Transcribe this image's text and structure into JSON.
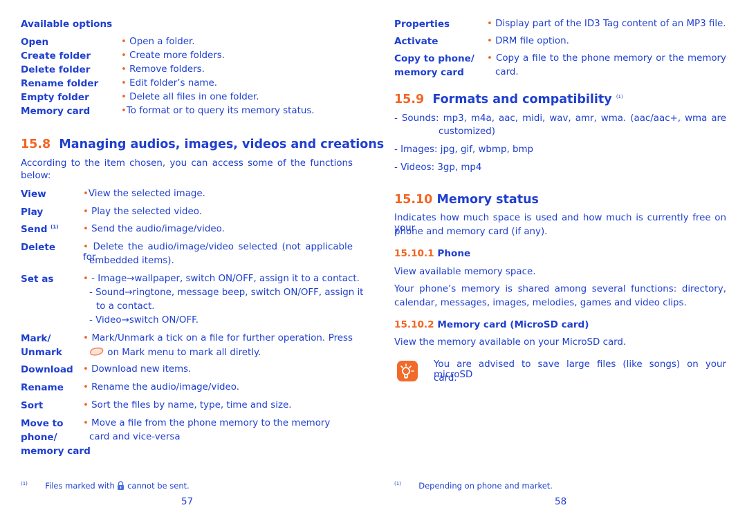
{
  "left_page": {
    "options_heading": "Available options",
    "folder_options": [
      {
        "term": "Open",
        "desc": "Open a folder."
      },
      {
        "term": "Create folder",
        "desc": "Create more folders."
      },
      {
        "term": "Delete folder",
        "desc": "Remove folders."
      },
      {
        "term": "Rename folder",
        "desc": "Edit folder’s name."
      },
      {
        "term": "Empty folder",
        "desc": "Delete all files in one folder."
      },
      {
        "term": "Memory card",
        "desc": "To format or to query its memory status."
      }
    ],
    "section": {
      "number": "15.8",
      "title": "Managing audios, images, videos and creations"
    },
    "intro_line1": "According to the item chosen, you can access some of the functions",
    "intro_line2": "below:",
    "functions": {
      "view": {
        "term": "View",
        "desc": "View the selected image."
      },
      "play": {
        "term": "Play",
        "desc": "Play the selected video."
      },
      "send": {
        "term": "Send",
        "sup": "(1)",
        "desc": "Send the audio/image/video."
      },
      "delete": {
        "term": "Delete",
        "desc_line1": "Delete the audio/image/video selected (not applicable for",
        "desc_line2": "embedded items)."
      },
      "set_as": {
        "term": "Set as",
        "line1": "- Image→wallpaper, switch ON/OFF, assign it to a contact.",
        "line2": "- Sound→ringtone, message beep, switch ON/OFF, assign it",
        "line3": "to a contact.",
        "line4": "- Video→switch ON/OFF."
      },
      "mark": {
        "term_line1": "Mark/",
        "term_line2": "Unmark",
        "desc_line1": "Mark/Unmark a tick on a file for further operation. Press",
        "desc_line2": "on Mark menu to mark all diretly."
      },
      "download": {
        "term": "Download",
        "desc": "Download new items."
      },
      "rename": {
        "term": "Rename",
        "desc": "Rename the audio/image/video."
      },
      "sort": {
        "term": "Sort",
        "desc": "Sort the files by name, type, time and size."
      },
      "move": {
        "term_line1": "Move to",
        "term_line2": "phone/",
        "term_line3": "memory card",
        "desc_line1": "Move a file from the phone memory to the memory",
        "desc_line2": "card and vice-versa"
      }
    },
    "footnote": {
      "marker": "(1)",
      "text_before": "Files marked with",
      "text_after": "cannot be sent."
    },
    "page_number": "57"
  },
  "right_page": {
    "functions": {
      "properties": {
        "term": "Properties",
        "desc": "Display part of the ID3 Tag content of an MP3 file."
      },
      "activate": {
        "term": "Activate",
        "desc": "DRM file option."
      },
      "copy": {
        "term_line1": "Copy to phone/",
        "term_line2": "memory card",
        "desc_line1": "Copy a file to the phone memory or the memory",
        "desc_line2": "card."
      }
    },
    "section_formats": {
      "number": "15.9",
      "title": "Formats and compatibility",
      "sup": "(1)"
    },
    "formats": {
      "sounds_line1": "- Sounds: mp3, m4a, aac, midi, wav, amr, wma. (aac/aac+, wma are",
      "sounds_line2": "customized)",
      "images": "- Images: jpg, gif, wbmp, bmp",
      "videos": "- Videos: 3gp, mp4"
    },
    "section_memory": {
      "number": "15.10",
      "title": "Memory status"
    },
    "memory_intro_line1": "Indicates how much space is used and how much is currently free on your",
    "memory_intro_line2": "phone and memory card (if any).",
    "sub_phone": {
      "number": "15.10.1",
      "title": "Phone"
    },
    "phone_text1": "View available memory space.",
    "phone_text2_line1": "Your phone’s memory is shared among several functions: directory,",
    "phone_text2_line2": "calendar, messages, images, melodies, games and video clips.",
    "sub_card": {
      "number": "15.10.2",
      "title": "Memory card (MicroSD card)"
    },
    "card_text": "View the memory available on your MicroSD card.",
    "tip_line1": "You are advised to save large files (like songs) on your microSD",
    "tip_line2": "card.",
    "footnote": {
      "marker": "(1)",
      "text": "Depending on phone and market."
    },
    "page_number": "58"
  },
  "colors": {
    "text": "#1f3fcf",
    "accent": "#f26522"
  }
}
